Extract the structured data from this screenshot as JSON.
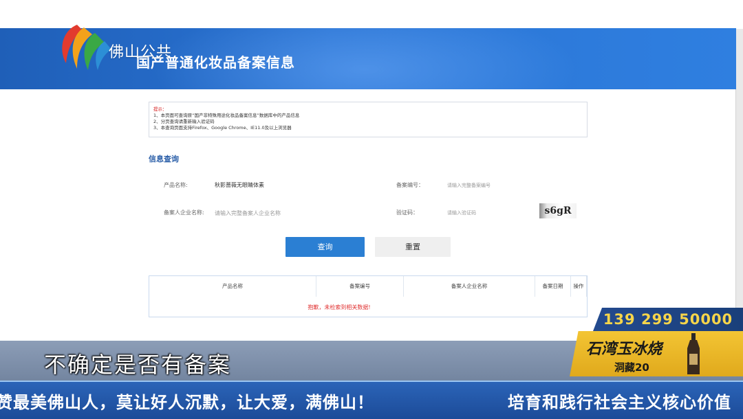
{
  "header": {
    "logo_text": "佛山公共",
    "page_title": "国产普通化妆品备案信息"
  },
  "notice": {
    "title": "提示：",
    "lines": [
      "1、本页面可查询原“国产非特殊用途化妆品备案信息”数据库中的产品信息",
      "2、分页查询请重新输入验证码",
      "3、本查询页面支持Firefox、Google Chrome、IE11.0及以上浏览器"
    ]
  },
  "query": {
    "section_title": "信息查询",
    "product_name_label": "产品名称:",
    "product_name_value": "秋影蔷薇无眼睛体素",
    "record_no_label": "备案编号：",
    "record_no_placeholder": "请输入完整备案编号",
    "company_label": "备案人企业名称:",
    "company_placeholder": "请输入完整备案人企业名称",
    "captcha_label": "验证码：",
    "captcha_placeholder": "请输入验证码",
    "captcha_text": "s6gR",
    "query_button": "查询",
    "reset_button": "重置"
  },
  "results": {
    "columns": [
      "产品名称",
      "备案编号",
      "备案人企业名称",
      "备案日期",
      "操作"
    ],
    "empty_message": "抱歉，未检索到相关数据!"
  },
  "overlay": {
    "subtitle": "不确定是否有备案",
    "ticker_left": "赞最美佛山人，莫让好人沉默，让大爱，满佛山！",
    "ticker_right": "培育和践行社会主义核心价值",
    "ad_phone": "139 299 50000",
    "ad_brand": "石湾玉冰烧",
    "ad_tag": "洞藏20"
  }
}
